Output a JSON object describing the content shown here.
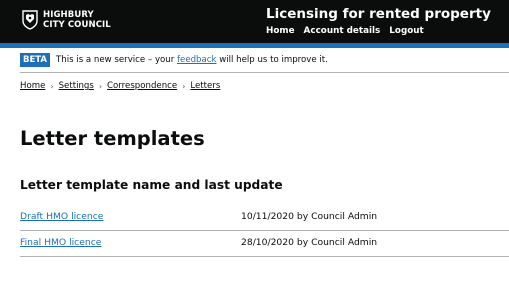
{
  "header": {
    "logo_line1": "HIGHBURY",
    "logo_line2": "CITY COUNCIL",
    "logo_icon": "council-crest-icon",
    "service_name": "Licensing for rented property",
    "nav": [
      {
        "label": "Home"
      },
      {
        "label": "Account details"
      },
      {
        "label": "Logout"
      }
    ]
  },
  "phase_banner": {
    "tag": "BETA",
    "text_before": "This is a new service – your ",
    "link": "feedback",
    "text_after": " will help us to improve it."
  },
  "breadcrumbs": [
    {
      "label": "Home"
    },
    {
      "label": "Settings"
    },
    {
      "label": "Correspondence"
    },
    {
      "label": "Letters"
    }
  ],
  "page": {
    "title": "Letter templates",
    "section_heading": "Letter template name and last update"
  },
  "templates": [
    {
      "name": "Draft HMO licence",
      "updated": "10/11/2020 by Council Admin"
    },
    {
      "name": "Final HMO licence",
      "updated": "28/10/2020 by Council Admin"
    }
  ],
  "colors": {
    "header_bg": "#0b0c0c",
    "brand_blue": "#1d70b8",
    "border": "#b1b4b6",
    "text": "#0b0c0c"
  }
}
